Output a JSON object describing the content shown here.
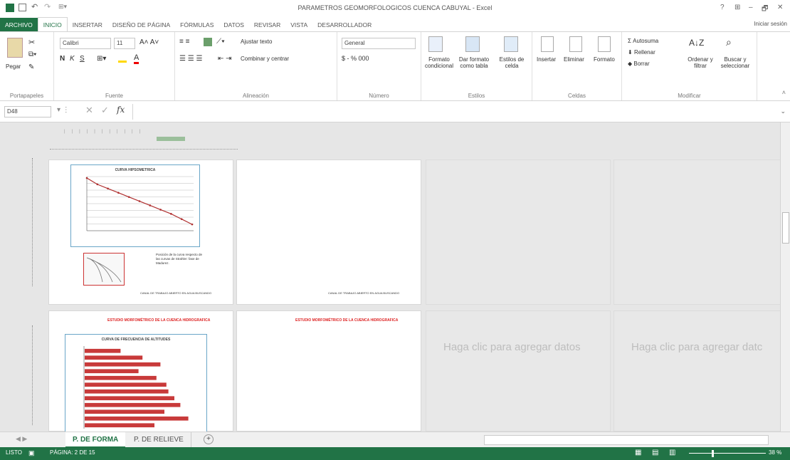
{
  "window": {
    "title": "PARAMETROS GEOMORFOLOGICOS CUENCA CABUYAL - Excel",
    "controls": [
      "?",
      "⊞",
      "–",
      "🗗",
      "✕"
    ],
    "sign_in": "Iniciar sesión"
  },
  "tabs": [
    "ARCHIVO",
    "INICIO",
    "INSERTAR",
    "DISEÑO DE PÁGINA",
    "FÓRMULAS",
    "DATOS",
    "REVISAR",
    "VISTA",
    "DESARROLLADOR"
  ],
  "ribbon": {
    "clipboard": {
      "paste": "Pegar",
      "label": "Portapapeles"
    },
    "font": {
      "name": "Calibri",
      "size": "11",
      "label": "Fuente"
    },
    "alignment": {
      "wrap": "Ajustar texto",
      "merge": "Combinar y centrar",
      "label": "Alineación"
    },
    "number": {
      "format": "General",
      "label": "Número",
      "symbols": "$ - % 000"
    },
    "styles": {
      "cond": "Formato condicional",
      "table": "Dar formato como tabla",
      "cell": "Estilos de celda",
      "label": "Estilos"
    },
    "cells": {
      "insert": "Insertar",
      "delete": "Eliminar",
      "format": "Formato",
      "label": "Celdas"
    },
    "editing": {
      "autosum": "Autosuma",
      "fill": "Rellenar",
      "clear": "Borrar",
      "sort": "Ordenar y filtrar",
      "find": "Buscar y seleccionar",
      "label": "Modificar"
    }
  },
  "formula_bar": {
    "name_box": "D48",
    "fx": "fx",
    "value": ""
  },
  "pages": {
    "chart1_title": "CURVA HIPSOMETRICA",
    "chart2_title": "CURVA DE FRECUENCIA DE ALTITUDES",
    "red_title": "ESTUDIO MORFOMÉTRICO DE LA CUENCA HIDROGRAFICA",
    "placeholder": "Haga clic para agregar datos",
    "placeholder2": "Haga clic para agregar datc",
    "note_text": "Posición de la curva respecto de las curvas de Strahler: fase de Madurez.",
    "footer": "CANAL DE TRABAJO ABIERTO EN AGUA BUSCANDO"
  },
  "sheet_tabs": [
    "P. DE FORMA",
    "P. DE RELIEVE"
  ],
  "status": {
    "mode": "LISTO",
    "page": "PÁGINA: 2 DE 15",
    "zoom": "38 %"
  },
  "chart_data": [
    {
      "type": "line",
      "title": "CURVA HIPSOMETRICA",
      "x": [
        0,
        10,
        20,
        30,
        40,
        50,
        60,
        70,
        80,
        90,
        100
      ],
      "y": [
        100,
        88,
        80,
        72,
        64,
        56,
        48,
        40,
        32,
        22,
        12
      ],
      "color": "#b03030"
    },
    {
      "type": "bar",
      "title": "CURVA DE FRECUENCIA DE ALTITUDES",
      "values": [
        36,
        58,
        76,
        54,
        72,
        82,
        84,
        90,
        96,
        80,
        104,
        70
      ],
      "color": "#c83a3a"
    }
  ]
}
